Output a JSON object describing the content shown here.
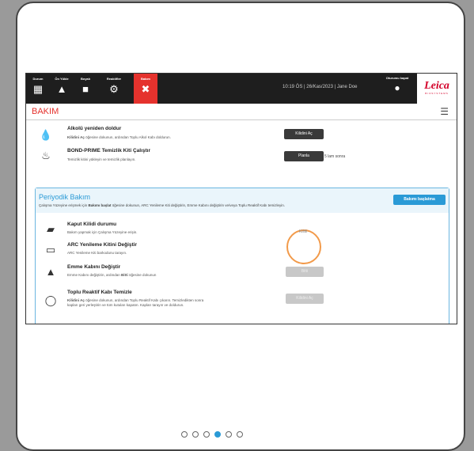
{
  "nav": [
    {
      "label": "Durum",
      "icon": "status-icon"
    },
    {
      "label": "Ön Yükle",
      "icon": "preload-icon"
    },
    {
      "label": "Boyalı",
      "icon": "stained-icon"
    },
    {
      "label": "Reaktifler",
      "icon": "reagents-icon"
    },
    {
      "label": "Bakım",
      "icon": "maintenance-icon",
      "active": true
    }
  ],
  "header": {
    "status": "10:19 ÖS  |  26/Kas/2023  |  Jane Doe",
    "logout_label": "Oturumu kapat",
    "logo_text": "Leica",
    "logo_sub": "BIOSYSTEMS"
  },
  "page": {
    "title": "BAKIM"
  },
  "top_items": [
    {
      "title": "Alkolü yeniden doldur",
      "desc_bold": "Kilidini Aç",
      "desc": " öğesine dokunun, ardından Toplu Alkol Kabı doldurun.",
      "button": "Kilidini Aç",
      "icon": "drop-icon"
    },
    {
      "title": "BOND-PRIME Temizlik Kiti Çalıştır",
      "desc": "Temizlik kitini yükleyin ve temizlik planlayın.",
      "button": "Planla",
      "note": "5 lam sonra",
      "icon": "cleaning-icon"
    }
  ],
  "panel": {
    "title": "Periyodik Bakım",
    "desc_pre": "Çalışma Yüzeyine erişmek için ",
    "desc_bold": "Bakımı başlat",
    "desc_post": " öğesine dokunun, ARC Yenileme Kiti değiştirin, Emme Kabını değiştirin ve/veya Toplu Reaktif Kabı temizleyin.",
    "start_button": "Bakımı başlatma",
    "items": [
      {
        "title": "Kaput Kilidi durumu",
        "desc": "Bakım yapmak için Çalışma Yüzeyine erişin.",
        "icon": "hood-icon"
      },
      {
        "title": "ARC Yenileme Kitini Değiştir",
        "desc": "ARC Yenileme Kiti barkodunu tarayın.",
        "icon": "arc-kit-icon"
      },
      {
        "title": "Emme Kabını Değiştir",
        "desc_pre": "Emme Kabını değiştirin, ardından ",
        "desc_bold": "Bitti",
        "desc_post": " öğesine dokunun",
        "button": "Bitti",
        "icon": "aspirator-icon"
      },
      {
        "title": "Toplu Reaktif Kabı Temizle",
        "desc_bold": "Kilidini Aç",
        "desc_post": " öğesine dokunun, ardından Toplu Reaktif Kabı çıkarın. Temizledikten sonra",
        "desc_line2": "kapları geri yerleştirin ve tüm kutuları kapatın. Kapları tarayın ve doldurun.",
        "button": "Kilidini Aç",
        "icon": "reagent-bottle-icon"
      }
    ],
    "highlight_label": "Kilitli"
  },
  "pagination": {
    "count": 6,
    "active": 3
  },
  "colors": {
    "accent": "#e5322d",
    "blue": "#2a9ad6",
    "highlight": "#f29a4a"
  }
}
